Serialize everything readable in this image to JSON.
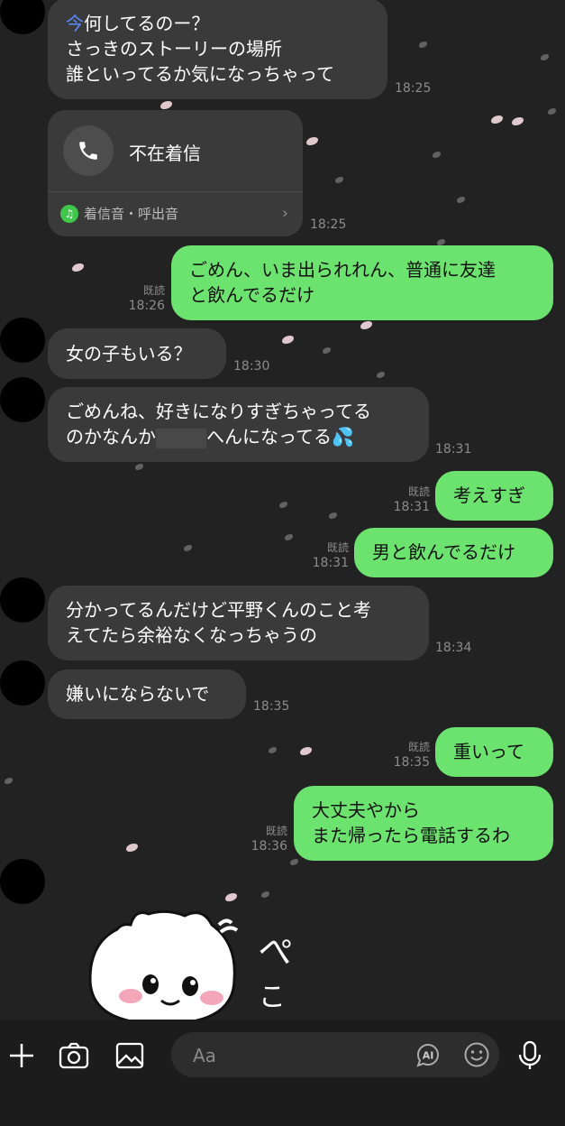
{
  "messages": {
    "m1": {
      "line1_hl": "今",
      "line1": "何してるのー？",
      "line2": "さっきのストーリーの場所",
      "line3": "誰といってるか気になっちゃって",
      "time": "18:25"
    },
    "call": {
      "title": "不在着信",
      "sub": "着信音・呼出音",
      "time": "18:25"
    },
    "m2": {
      "line1": "ごめん、いま出られれん、普通に友達",
      "line2": "と飲んでるだけ",
      "read": "既読",
      "time": "18:26"
    },
    "m3": {
      "text": "女の子もいる？",
      "time": "18:30"
    },
    "m4": {
      "line1": "ごめんね、好きになりすぎちゃってる",
      "line2a": "のかなんか",
      "line2b": "へんになってる",
      "emoji": "💦",
      "time": "18:31"
    },
    "m5": {
      "text": "考えすぎ",
      "read": "既読",
      "time": "18:31"
    },
    "m6": {
      "text": "男と飲んでるだけ",
      "read": "既読",
      "time": "18:31"
    },
    "m7": {
      "line1": "分かってるんだけど平野くんのこと考",
      "line2": "えてたら余裕なくなっちゃうの",
      "time": "18:34"
    },
    "m8": {
      "text": "嫌いにならないで",
      "time": "18:35"
    },
    "m9": {
      "text": "重いって",
      "read": "既読",
      "time": "18:35"
    },
    "m10": {
      "line1": "大丈夫やから",
      "line2": "また帰ったら電話するわ",
      "read": "既読",
      "time": "18:36"
    }
  },
  "sticker": {
    "text1": "ぺ",
    "text2": "こ"
  },
  "input": {
    "placeholder": "Aa",
    "ai_label": "AI"
  },
  "icons": [
    "plus-icon",
    "camera-icon",
    "image-icon",
    "ai-icon",
    "emoji-icon",
    "mic-icon",
    "phone-icon",
    "music-icon"
  ],
  "colors": {
    "background": "#222222",
    "incoming": "#3a3a3a",
    "outgoing": "#6de36f"
  }
}
